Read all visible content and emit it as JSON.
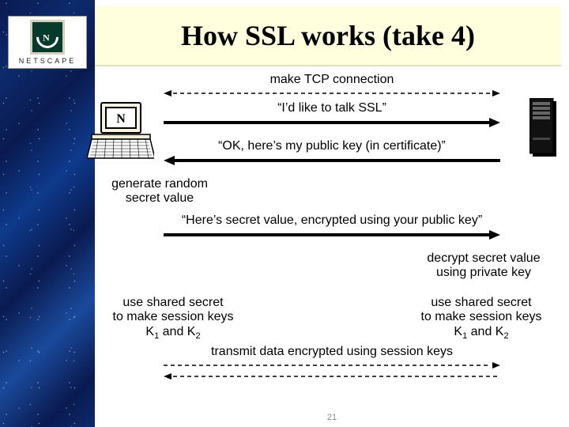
{
  "brand": {
    "name": "NETSCAPE",
    "icon_letter": "N"
  },
  "slide": {
    "title": "How SSL works (take 4)",
    "page_number": "21"
  },
  "steps": {
    "s1": "make TCP connection",
    "s2": "“I’d like to talk SSL”",
    "s3": "“OK, here’s my public key (in certificate)”",
    "s4": "“Here’s secret value, encrypted using your public key”",
    "s5": "transmit data encrypted using session keys"
  },
  "notes": {
    "client_gen": "generate random\nsecret value",
    "server_decrypt": "decrypt secret value\nusing private key",
    "client_keys_l1": "use shared secret",
    "client_keys_l2": "to make session keys",
    "client_keys_l3_pre": "K",
    "client_keys_l3_sub1": "1",
    "client_keys_l3_mid": " and K",
    "client_keys_l3_sub2": "2",
    "server_keys_l1": "use shared secret",
    "server_keys_l2": "to make session keys",
    "server_keys_l3_pre": "K",
    "server_keys_l3_sub1": "1",
    "server_keys_l3_mid": " and K",
    "server_keys_l3_sub2": "2"
  },
  "icons": {
    "client": "client-computer-icon",
    "server": "server-icon"
  }
}
